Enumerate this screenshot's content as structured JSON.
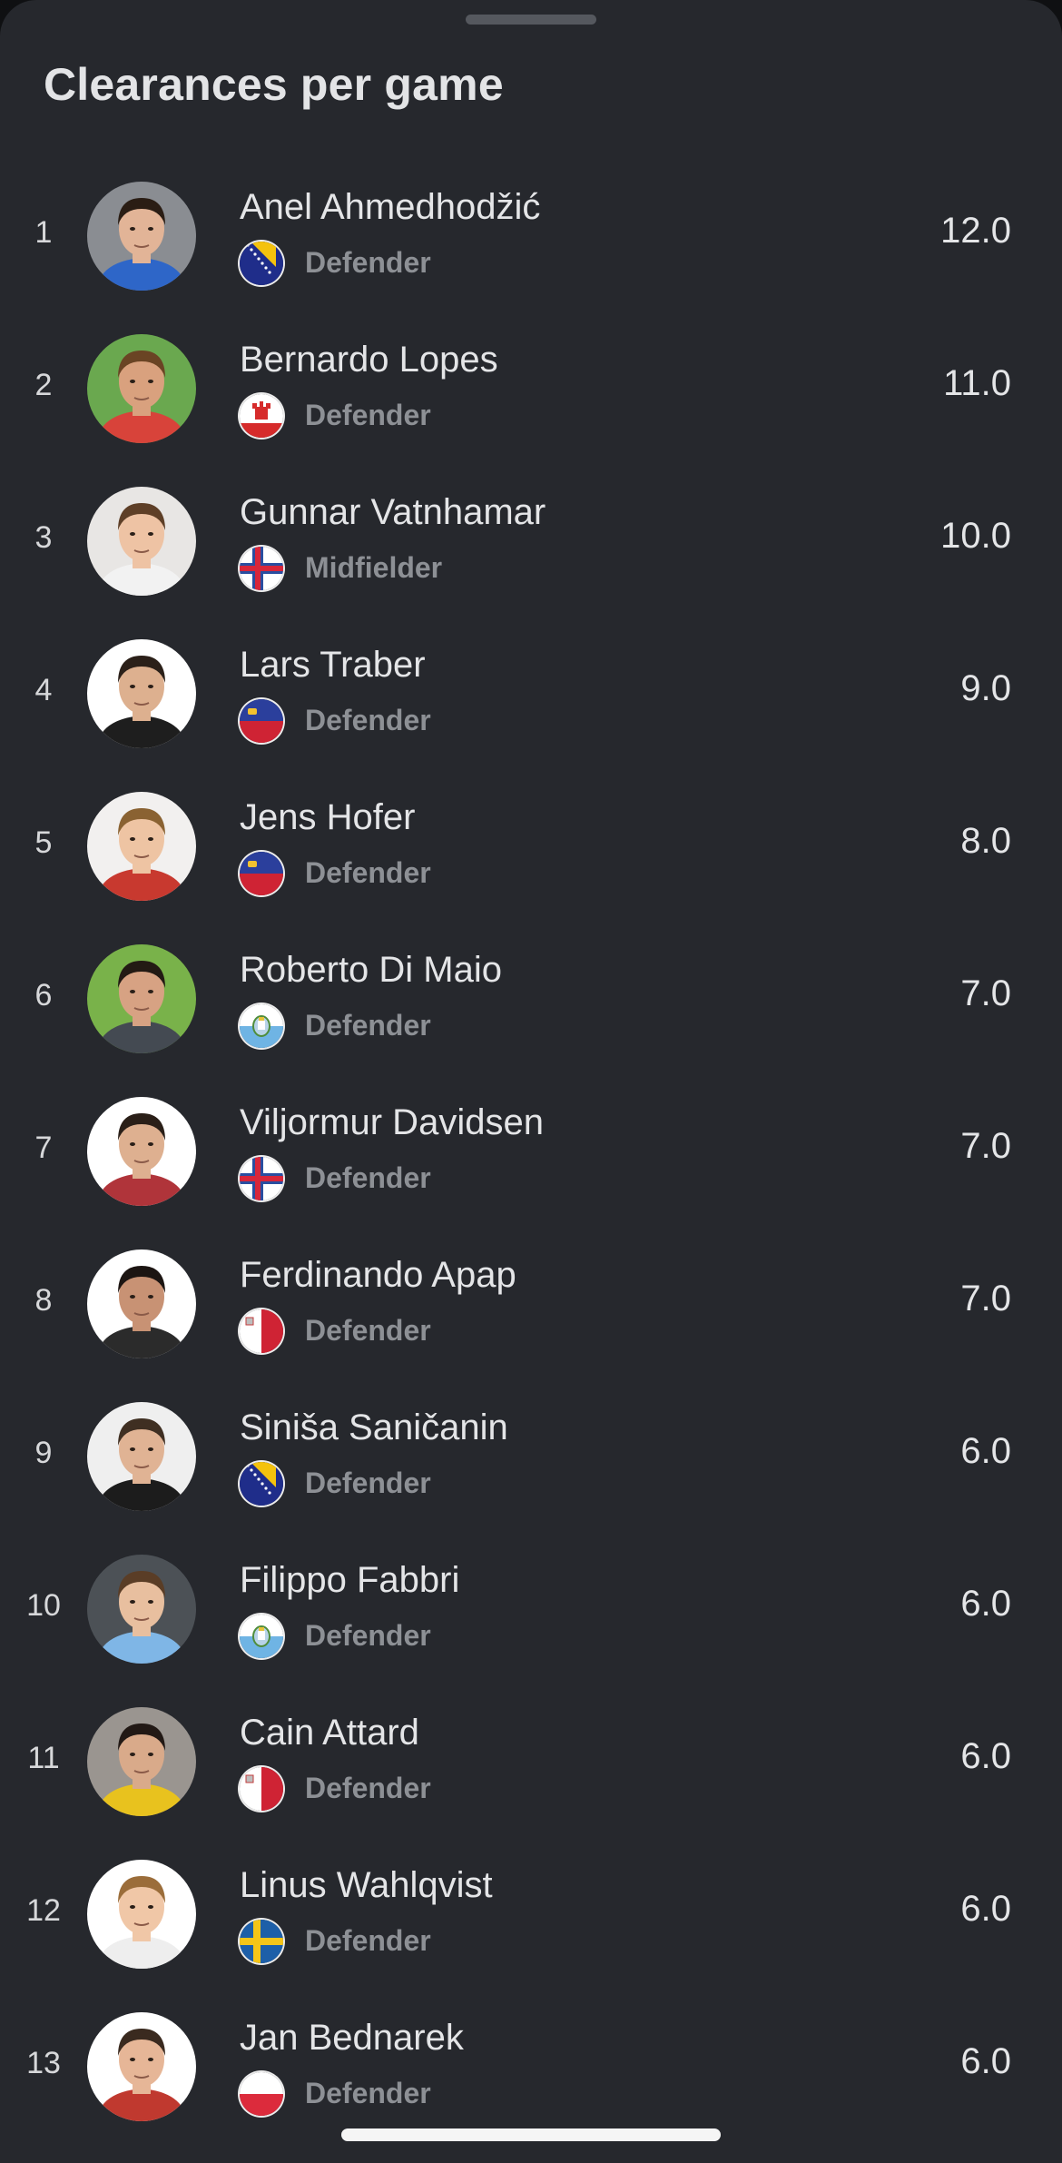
{
  "sheet": {
    "title": "Clearances per game"
  },
  "players": [
    {
      "rank": "1",
      "name": "Anel Ahmedhodžić",
      "position": "Defender",
      "value": "12.0",
      "flag": "bosnia-herzegovina",
      "avatar_bg": "#8a8d92",
      "skin": "#e2b497",
      "hair": "#2a1d14",
      "shirt": "#2e66c8"
    },
    {
      "rank": "2",
      "name": "Bernardo Lopes",
      "position": "Defender",
      "value": "11.0",
      "flag": "gibraltar",
      "avatar_bg": "#6aa84f",
      "skin": "#d9a17e",
      "hair": "#6a4424",
      "shirt": "#d8433a"
    },
    {
      "rank": "3",
      "name": "Gunnar Vatnhamar",
      "position": "Midfielder",
      "value": "10.0",
      "flag": "faroe-islands",
      "avatar_bg": "#e8e6e4",
      "skin": "#eec3a4",
      "hair": "#5e3f27",
      "shirt": "#f2f2f2"
    },
    {
      "rank": "4",
      "name": "Lars Traber",
      "position": "Defender",
      "value": "9.0",
      "flag": "liechtenstein",
      "avatar_bg": "#ffffff",
      "skin": "#ddb08f",
      "hair": "#2b2019",
      "shirt": "#1e1e1e"
    },
    {
      "rank": "5",
      "name": "Jens Hofer",
      "position": "Defender",
      "value": "8.0",
      "flag": "liechtenstein",
      "avatar_bg": "#f2f0ef",
      "skin": "#eec4a3",
      "hair": "#8a6232",
      "shirt": "#c8392f"
    },
    {
      "rank": "6",
      "name": "Roberto Di Maio",
      "position": "Defender",
      "value": "7.0",
      "flag": "san-marino",
      "avatar_bg": "#79b24a",
      "skin": "#d7a283",
      "hair": "#231a14",
      "shirt": "#444a52"
    },
    {
      "rank": "7",
      "name": "Viljormur Davidsen",
      "position": "Defender",
      "value": "7.0",
      "flag": "faroe-islands",
      "avatar_bg": "#ffffff",
      "skin": "#deb090",
      "hair": "#2a1f18",
      "shirt": "#b0343a"
    },
    {
      "rank": "8",
      "name": "Ferdinando Apap",
      "position": "Defender",
      "value": "7.0",
      "flag": "malta",
      "avatar_bg": "#ffffff",
      "skin": "#c89274",
      "hair": "#1c1512",
      "shirt": "#2b2b2b"
    },
    {
      "rank": "9",
      "name": "Siniša Saničanin",
      "position": "Defender",
      "value": "6.0",
      "flag": "bosnia-herzegovina",
      "avatar_bg": "#efefef",
      "skin": "#e0b394",
      "hair": "#3f2f22",
      "shirt": "#1c1c1c"
    },
    {
      "rank": "10",
      "name": "Filippo Fabbri",
      "position": "Defender",
      "value": "6.0",
      "flag": "san-marino",
      "avatar_bg": "#4c5156",
      "skin": "#e8bf9f",
      "hair": "#5a3d26",
      "shirt": "#7fb6e6"
    },
    {
      "rank": "11",
      "name": "Cain Attard",
      "position": "Defender",
      "value": "6.0",
      "flag": "malta",
      "avatar_bg": "#9a9590",
      "skin": "#d9aa8a",
      "hair": "#221915",
      "shirt": "#e8c21e"
    },
    {
      "rank": "12",
      "name": "Linus Wahlqvist",
      "position": "Defender",
      "value": "6.0",
      "flag": "sweden",
      "avatar_bg": "#ffffff",
      "skin": "#f0c7a7",
      "hair": "#9b6d3a",
      "shirt": "#eeeeee"
    },
    {
      "rank": "13",
      "name": "Jan Bednarek",
      "position": "Defender",
      "value": "6.0",
      "flag": "poland",
      "avatar_bg": "#ffffff",
      "skin": "#e6b697",
      "hair": "#3a2a1f",
      "shirt": "#c0392f"
    }
  ]
}
